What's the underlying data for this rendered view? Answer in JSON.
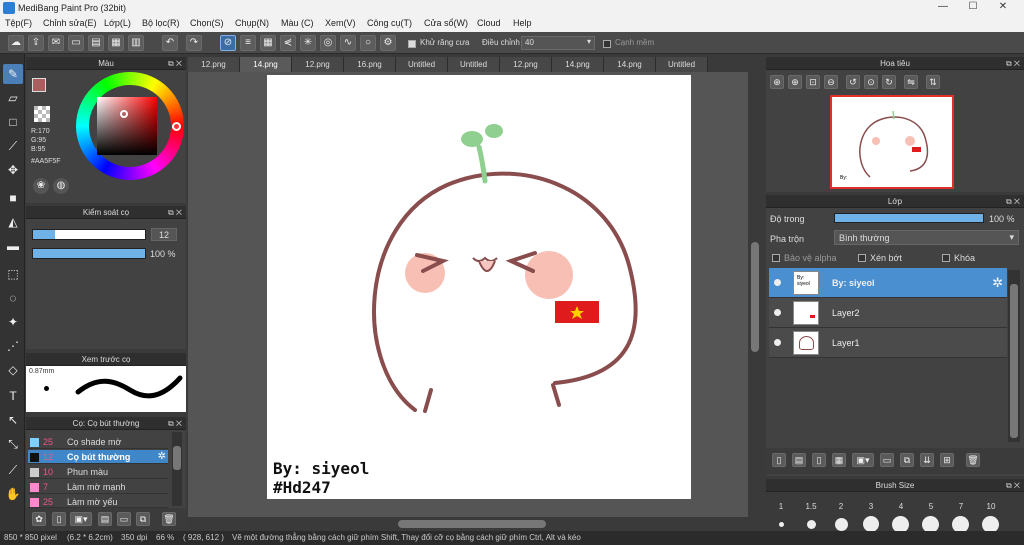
{
  "window": {
    "title": "MediBang Paint Pro (32bit)",
    "minimize": "—",
    "maximize": "☐",
    "close": "✕"
  },
  "menu": [
    "Tệp(F)",
    "Chỉnh sửa(E)",
    "Lớp(L)",
    "Bộ lọc(R)",
    "Chọn(S)",
    "Chụp(N)",
    "Màu (C)",
    "Xem(V)",
    "Công cụ(T)",
    "Cửa sổ(W)",
    "Cloud",
    "Help"
  ],
  "toolbar": {
    "antialias_label": "Khử răng cưa",
    "adjust_label": "Điều chỉnh",
    "adjust_value": "40",
    "edge_label": "Cạnh mềm"
  },
  "color_panel": {
    "title": "Màu",
    "r": "R:170",
    "g": "G:95",
    "b": "B:95",
    "hex": "#AA5F5F",
    "accent": "#AA5F5F"
  },
  "brush_control": {
    "title": "Kiểm soát cọ",
    "size": "12",
    "opacity": "100 %",
    "size_fill": 0.2,
    "opacity_fill": 1.0
  },
  "brush_preview": {
    "title": "Xem trước cọ",
    "size_label": "0.87mm"
  },
  "brush_list": {
    "title": "Cọ: Cọ bút thường",
    "items": [
      {
        "num": "25",
        "name": "Cọ shade mờ",
        "color": "#7fd0ff"
      },
      {
        "num": "12",
        "name": "Cọ bút thường",
        "color": "#111111"
      },
      {
        "num": "10",
        "name": "Phun màu",
        "color": "#cccccc"
      },
      {
        "num": "7",
        "name": "Làm mờ mạnh",
        "color": "#ff88cc"
      },
      {
        "num": "25",
        "name": "Làm mờ yếu",
        "color": "#ff88cc"
      }
    ]
  },
  "tabs": [
    "12.png",
    "14.png",
    "12.png",
    "16.png",
    "Untitled",
    "Untitled",
    "12.png",
    "14.png",
    "14.png",
    "Untitled"
  ],
  "canvas": {
    "signature_line1": "By: siyeol",
    "signature_line2": "#Hd247"
  },
  "navigator": {
    "title": "Hoa tiêu"
  },
  "layers": {
    "title": "Lớp",
    "opacity_label": "Độ trong",
    "opacity_value": "100 %",
    "blend_label": "Pha trộn",
    "blend_value": "Bình thường",
    "protect_alpha": "Bảo vệ alpha",
    "clipping": "Xén bớt",
    "lock": "Khóa",
    "items": [
      {
        "name": "By: siyeol"
      },
      {
        "name": "Layer2"
      },
      {
        "name": "Layer1"
      }
    ]
  },
  "brush_size": {
    "title": "Brush Size",
    "sizes": [
      "1",
      "1.5",
      "2",
      "3",
      "4",
      "5",
      "7",
      "10"
    ]
  },
  "status": {
    "dimensions": "850 * 850 pixel",
    "physical": "(6.2 * 6.2cm)",
    "dpi": "350 dpi",
    "zoom": "66 %",
    "coords": "( 928, 612 )",
    "hint": "Vẽ một đường thẳng bằng cách giữ phím Shift, Thay đổi cỡ cọ bằng cách giữ phím Ctrl, Alt và kéo"
  }
}
